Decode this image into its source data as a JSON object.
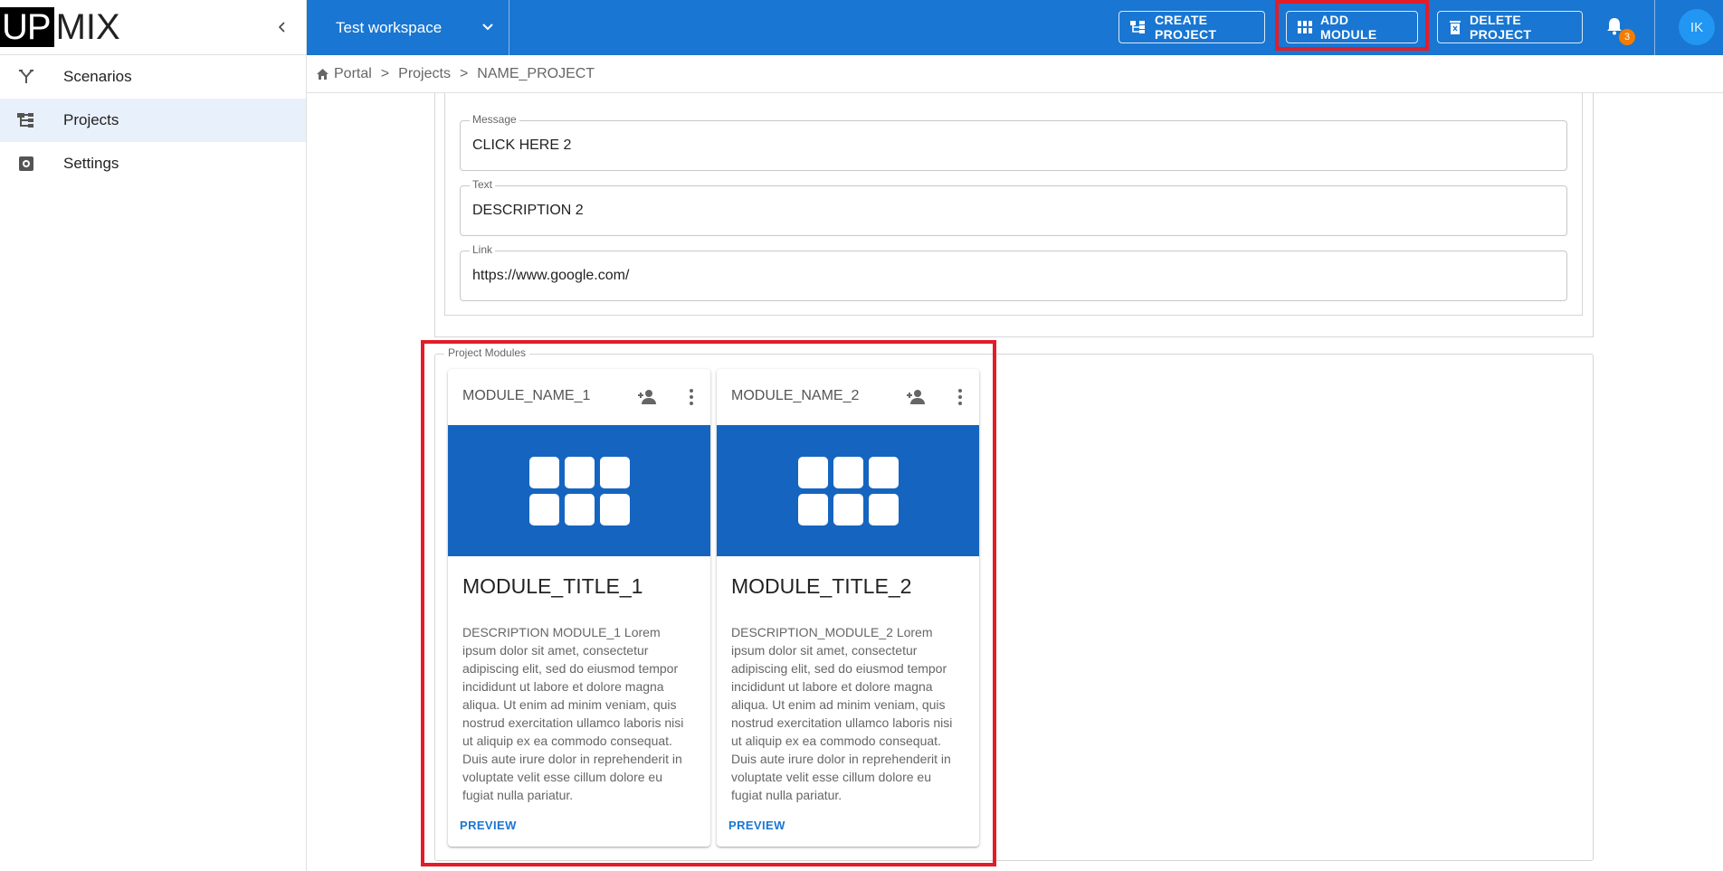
{
  "brand": {
    "up": "UP",
    "mix": "MIX"
  },
  "sidebar": {
    "items": [
      {
        "label": "Scenarios",
        "icon": "scenarios-icon",
        "active": false
      },
      {
        "label": "Projects",
        "icon": "projects-icon",
        "active": true
      },
      {
        "label": "Settings",
        "icon": "settings-icon",
        "active": false
      }
    ]
  },
  "topbar": {
    "workspace": "Test workspace",
    "create_project": "CREATE PROJECT",
    "add_module": "ADD MODULE",
    "delete_project": "DELETE PROJECT",
    "notifications_count": "3",
    "avatar_initials": "IK",
    "accent_color": "#1976d2"
  },
  "breadcrumb": {
    "items": [
      "Portal",
      "Projects",
      "NAME_PROJECT"
    ],
    "separator": ">"
  },
  "additional_section": {
    "fields": [
      {
        "label": "Message",
        "value": "CLICK HERE 2"
      },
      {
        "label": "Text",
        "value": "DESCRIPTION 2"
      },
      {
        "label": "Link",
        "value": "https://www.google.com/"
      }
    ]
  },
  "modules": {
    "legend": "Project Modules",
    "cards": [
      {
        "name": "MODULE_NAME_1",
        "title": "MODULE_TITLE_1",
        "description": "DESCRIPTION MODULE_1 Lorem ipsum dolor sit amet, consectetur adipiscing elit, sed do eiusmod tempor incididunt ut labore et dolore magna aliqua. Ut enim ad minim veniam, quis nostrud exercitation ullamco laboris nisi ut aliquip ex ea commodo consequat. Duis aute irure dolor in reprehenderit in voluptate velit esse cillum dolore eu fugiat nulla pariatur.",
        "action": "PREVIEW"
      },
      {
        "name": "MODULE_NAME_2",
        "title": "MODULE_TITLE_2",
        "description": "DESCRIPTION_MODULE_2 Lorem ipsum dolor sit amet, consectetur adipiscing elit, sed do eiusmod tempor incididunt ut labore et dolore magna aliqua. Ut enim ad minim veniam, quis nostrud exercitation ullamco laboris nisi ut aliquip ex ea commodo consequat. Duis aute irure dolor in reprehenderit in voluptate velit esse cillum dolore eu fugiat nulla pariatur.",
        "action": "PREVIEW"
      }
    ]
  },
  "highlight_color": "#e11d2a"
}
